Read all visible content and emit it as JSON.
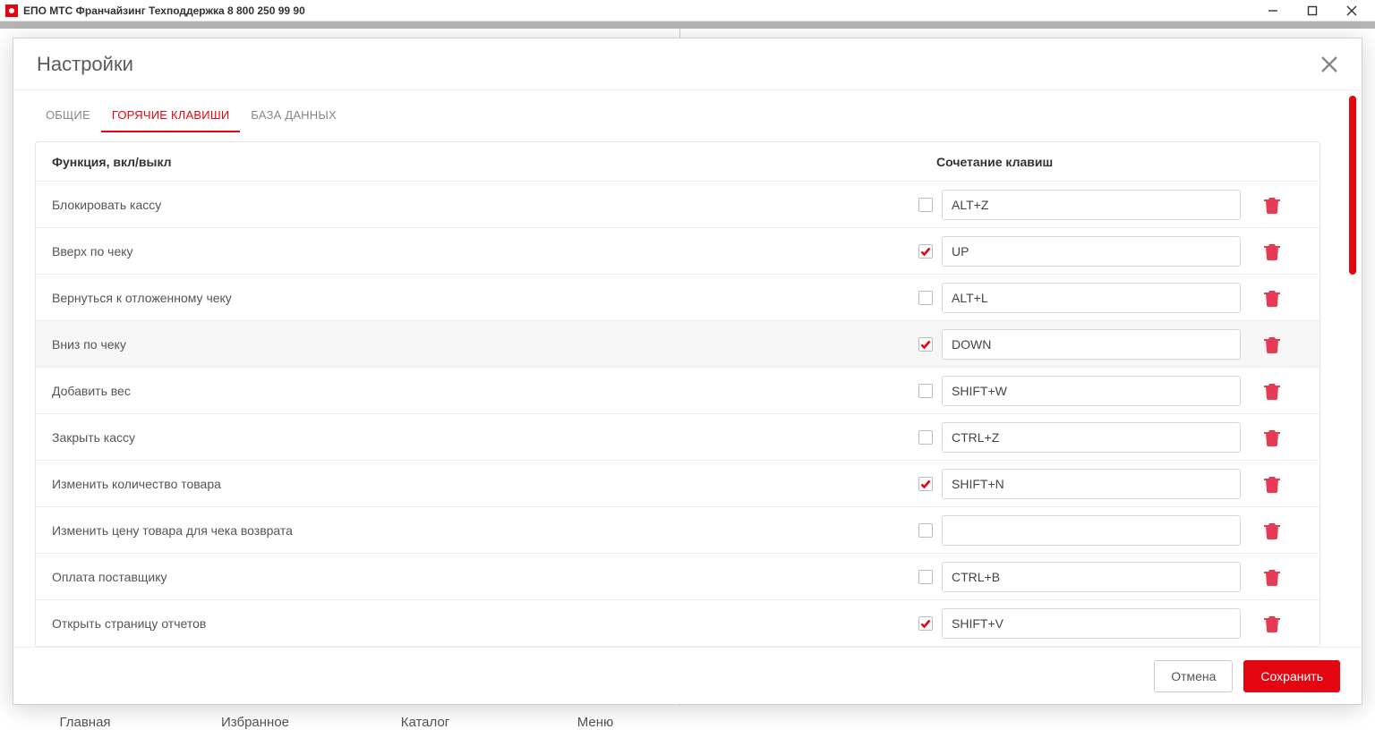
{
  "titlebar": {
    "app_title": "ЕПО МТС Франчайзинг Техподдержка 8 800 250 99 90"
  },
  "bottom_nav": [
    "Главная",
    "Избранное",
    "Каталог",
    "Меню"
  ],
  "modal": {
    "title": "Настройки",
    "tabs": [
      "ОБЩИЕ",
      "ГОРЯЧИЕ КЛАВИШИ",
      "БАЗА ДАННЫХ"
    ],
    "active_tab": 1,
    "header_func": "Функция, вкл/выкл",
    "header_combo": "Сочетание клавиш",
    "rows": [
      {
        "label": "Блокировать кассу",
        "checked": false,
        "combo": "ALT+Z",
        "hover": false
      },
      {
        "label": "Вверх по чеку",
        "checked": true,
        "combo": "UP",
        "hover": false
      },
      {
        "label": "Вернуться к отложенному чеку",
        "checked": false,
        "combo": "ALT+L",
        "hover": false
      },
      {
        "label": "Вниз по чеку",
        "checked": true,
        "combo": "DOWN",
        "hover": true
      },
      {
        "label": "Добавить вес",
        "checked": false,
        "combo": "SHIFT+W",
        "hover": false
      },
      {
        "label": "Закрыть кассу",
        "checked": false,
        "combo": "CTRL+Z",
        "hover": false
      },
      {
        "label": "Изменить количество товара",
        "checked": true,
        "combo": "SHIFT+N",
        "hover": false
      },
      {
        "label": "Изменить цену товара для чека возврата",
        "checked": false,
        "combo": "",
        "hover": false
      },
      {
        "label": "Оплата поставщику",
        "checked": false,
        "combo": "CTRL+B",
        "hover": false
      },
      {
        "label": "Открыть страницу отчетов",
        "checked": true,
        "combo": "SHIFT+V",
        "hover": false
      }
    ],
    "cancel": "Отмена",
    "save": "Сохранить"
  }
}
